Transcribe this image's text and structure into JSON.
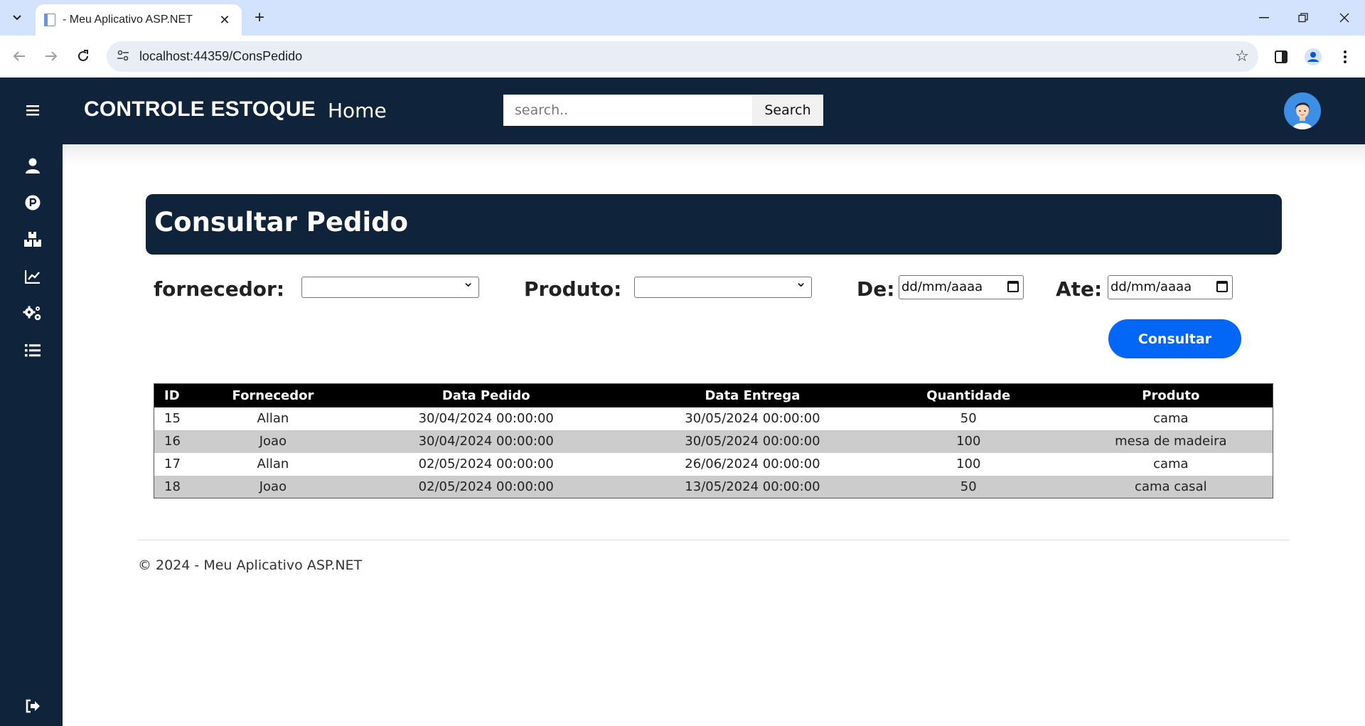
{
  "browser": {
    "tab_title": "- Meu Aplicativo ASP.NET",
    "url": "localhost:44359/ConsPedido"
  },
  "app": {
    "brand": "CONTROLE ESTOQUE",
    "nav_home": "Home",
    "search_placeholder": "search..",
    "search_button": "Search"
  },
  "sidebar": {
    "items": [
      "menu-icon",
      "user-icon",
      "parking-icon",
      "boxes-icon",
      "chart-line-icon",
      "gears-icon",
      "list-icon",
      "logout-icon"
    ]
  },
  "page": {
    "title": "Consultar Pedido",
    "filters": {
      "fornecedor_label": "fornecedor:",
      "produto_label": "Produto:",
      "de_label": "De:",
      "ate_label": "Ate:",
      "date_placeholder": "dd/mm/aaaa",
      "fornecedor_value": "",
      "produto_value": ""
    },
    "consultar_button": "Consultar"
  },
  "table": {
    "columns": [
      "ID",
      "Fornecedor",
      "Data Pedido",
      "Data Entrega",
      "Quantidade",
      "Produto"
    ],
    "rows": [
      [
        "15",
        "Allan",
        "30/04/2024 00:00:00",
        "30/05/2024 00:00:00",
        "50",
        "cama"
      ],
      [
        "16",
        "Joao",
        "30/04/2024 00:00:00",
        "30/05/2024 00:00:00",
        "100",
        "mesa de madeira"
      ],
      [
        "17",
        "Allan",
        "02/05/2024 00:00:00",
        "26/06/2024 00:00:00",
        "100",
        "cama"
      ],
      [
        "18",
        "Joao",
        "02/05/2024 00:00:00",
        "13/05/2024 00:00:00",
        "50",
        "cama casal"
      ]
    ]
  },
  "footer": {
    "text": "© 2024 - Meu Aplicativo ASP.NET"
  },
  "colors": {
    "navy": "#0f233a",
    "primary_button": "#0266f7",
    "alt_row": "#cccccc"
  }
}
